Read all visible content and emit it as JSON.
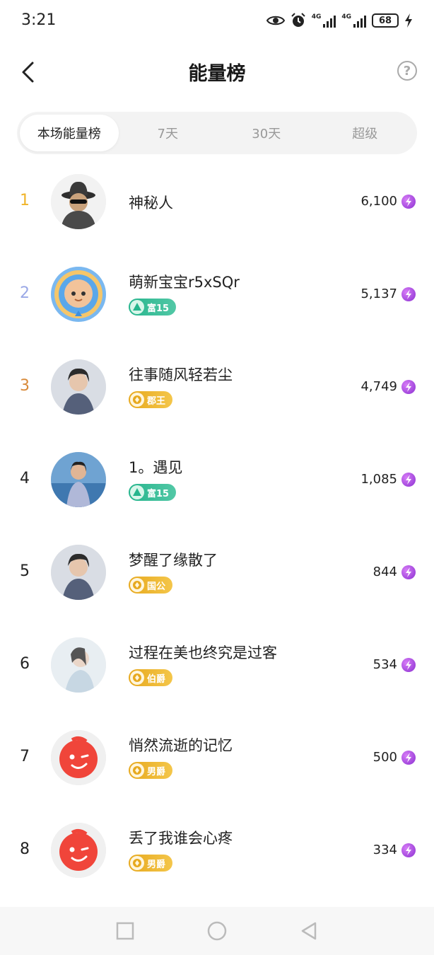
{
  "status": {
    "time": "3:21",
    "sig1": "4G",
    "sig2": "4G",
    "battery": "68"
  },
  "header": {
    "title": "能量榜",
    "help": "?"
  },
  "tabs": [
    {
      "label": "本场能量榜",
      "active": true
    },
    {
      "label": "7天",
      "active": false
    },
    {
      "label": "30天",
      "active": false
    },
    {
      "label": "超级",
      "active": false
    }
  ],
  "rows": [
    {
      "rank": "1",
      "rank_color": "#f0b429",
      "name": "神秘人",
      "score": "6,100",
      "badge": null,
      "avatar": "mystery-man"
    },
    {
      "rank": "2",
      "rank_color": "#9aa8e6",
      "name": "萌新宝宝r5xSQr",
      "score": "5,137",
      "badge": {
        "text": "富15",
        "style": "green"
      },
      "avatar": "baby-cartoon"
    },
    {
      "rank": "3",
      "rank_color": "#d88a3a",
      "name": "往事随风轻若尘",
      "score": "4,749",
      "badge": {
        "text": "郡王",
        "style": "gold"
      },
      "avatar": "photo"
    },
    {
      "rank": "4",
      "rank_color": "#222222",
      "name": "1。遇见",
      "score": "1,085",
      "badge": {
        "text": "富15",
        "style": "green"
      },
      "avatar": "photo-sea"
    },
    {
      "rank": "5",
      "rank_color": "#222222",
      "name": "梦醒了缘散了",
      "score": "844",
      "badge": {
        "text": "国公",
        "style": "gold"
      },
      "avatar": "photo"
    },
    {
      "rank": "6",
      "rank_color": "#222222",
      "name": "过程在美也终究是过客",
      "score": "534",
      "badge": {
        "text": "伯爵",
        "style": "gold"
      },
      "avatar": "photo-light"
    },
    {
      "rank": "7",
      "rank_color": "#222222",
      "name": "悄然流逝的记忆",
      "score": "500",
      "badge": {
        "text": "男爵",
        "style": "gold"
      },
      "avatar": "red-wink"
    },
    {
      "rank": "8",
      "rank_color": "#222222",
      "name": "丢了我谁会心疼",
      "score": "334",
      "badge": {
        "text": "男爵",
        "style": "gold"
      },
      "avatar": "red-wink"
    }
  ],
  "colors": {
    "accent_gold": "#f0b429",
    "badge_green": "#26b58d",
    "badge_gold": "#e7a91e",
    "energy_purple": "#a63ee0"
  }
}
